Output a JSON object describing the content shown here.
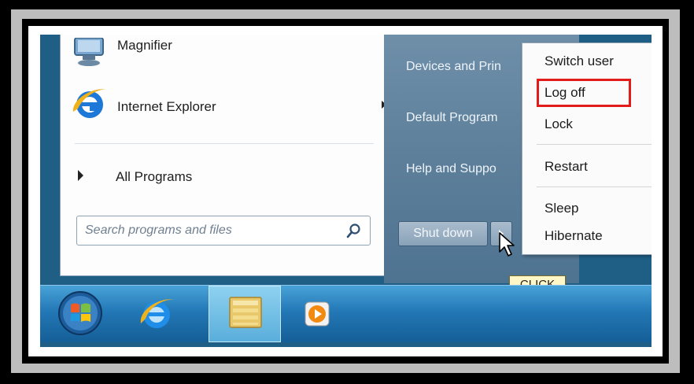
{
  "left_pane": {
    "magnifier_label": "Magnifier",
    "internet_explorer_label": "Internet Explorer",
    "all_programs_label": "All Programs",
    "search_placeholder": "Search programs and files"
  },
  "right_pane": {
    "devices_label": "Devices and Prin",
    "default_programs_label": "Default Program",
    "help_label": "Help and Suppo",
    "shutdown_label": "Shut down"
  },
  "submenu": {
    "switch_user": "Switch user",
    "log_off": "Log off",
    "lock": "Lock",
    "restart": "Restart",
    "sleep": "Sleep",
    "hibernate": "Hibernate"
  },
  "tooltip": {
    "click_label": "CLICK"
  },
  "colors": {
    "highlight_border": "#e21b1b",
    "taskbar": "#2378b6",
    "right_pane": "#5d7f9a"
  },
  "icons": {
    "magnifier": "magnifier-icon",
    "internet_explorer": "internet-explorer-icon",
    "search": "search-icon",
    "start": "windows-start-orb-icon",
    "explorer": "folder-explorer-icon",
    "media": "media-player-icon",
    "cursor": "mouse-cursor-icon"
  }
}
